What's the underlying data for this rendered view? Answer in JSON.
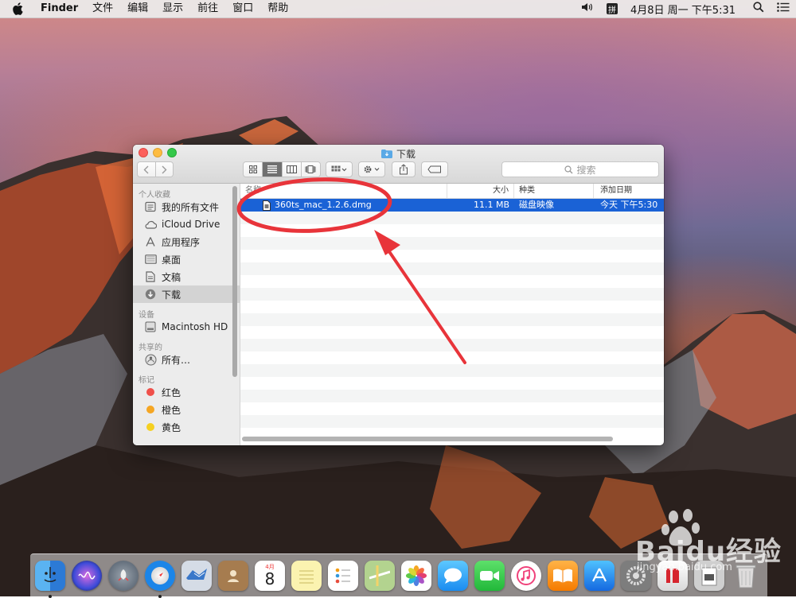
{
  "menubar": {
    "app_name": "Finder",
    "menus": [
      "文件",
      "编辑",
      "显示",
      "前往",
      "窗口",
      "帮助"
    ],
    "ime_label": "拼",
    "clock": "4月8日 周一 下午5:31"
  },
  "window": {
    "title": "下载",
    "search_placeholder": "搜索"
  },
  "sidebar": {
    "sections": {
      "favorites": "个人收藏",
      "devices": "设备",
      "shared": "共享的",
      "tags": "标记"
    },
    "favorites": [
      "我的所有文件",
      "iCloud Drive",
      "应用程序",
      "桌面",
      "文稿",
      "下载"
    ],
    "devices": [
      "Macintosh HD"
    ],
    "shared": [
      "所有…"
    ],
    "tags": [
      {
        "label": "红色",
        "color": "#f0504a"
      },
      {
        "label": "橙色",
        "color": "#f5a623"
      },
      {
        "label": "黄色",
        "color": "#f5d020"
      }
    ]
  },
  "columns": {
    "name": "名称",
    "size": "大小",
    "kind": "种类",
    "date_added": "添加日期"
  },
  "files": [
    {
      "name": "360ts_mac_1.2.6.dmg",
      "size": "11.1 MB",
      "kind": "磁盘映像",
      "date_added": "今天 下午5:30"
    }
  ],
  "colors": {
    "selection": "#1a62d6",
    "annotation": "#e8343a"
  },
  "dock": {
    "calendar_month": "4月",
    "calendar_day": "8"
  },
  "watermark": {
    "text": "Baidu经验",
    "url": "jingyan.baidu.com"
  }
}
